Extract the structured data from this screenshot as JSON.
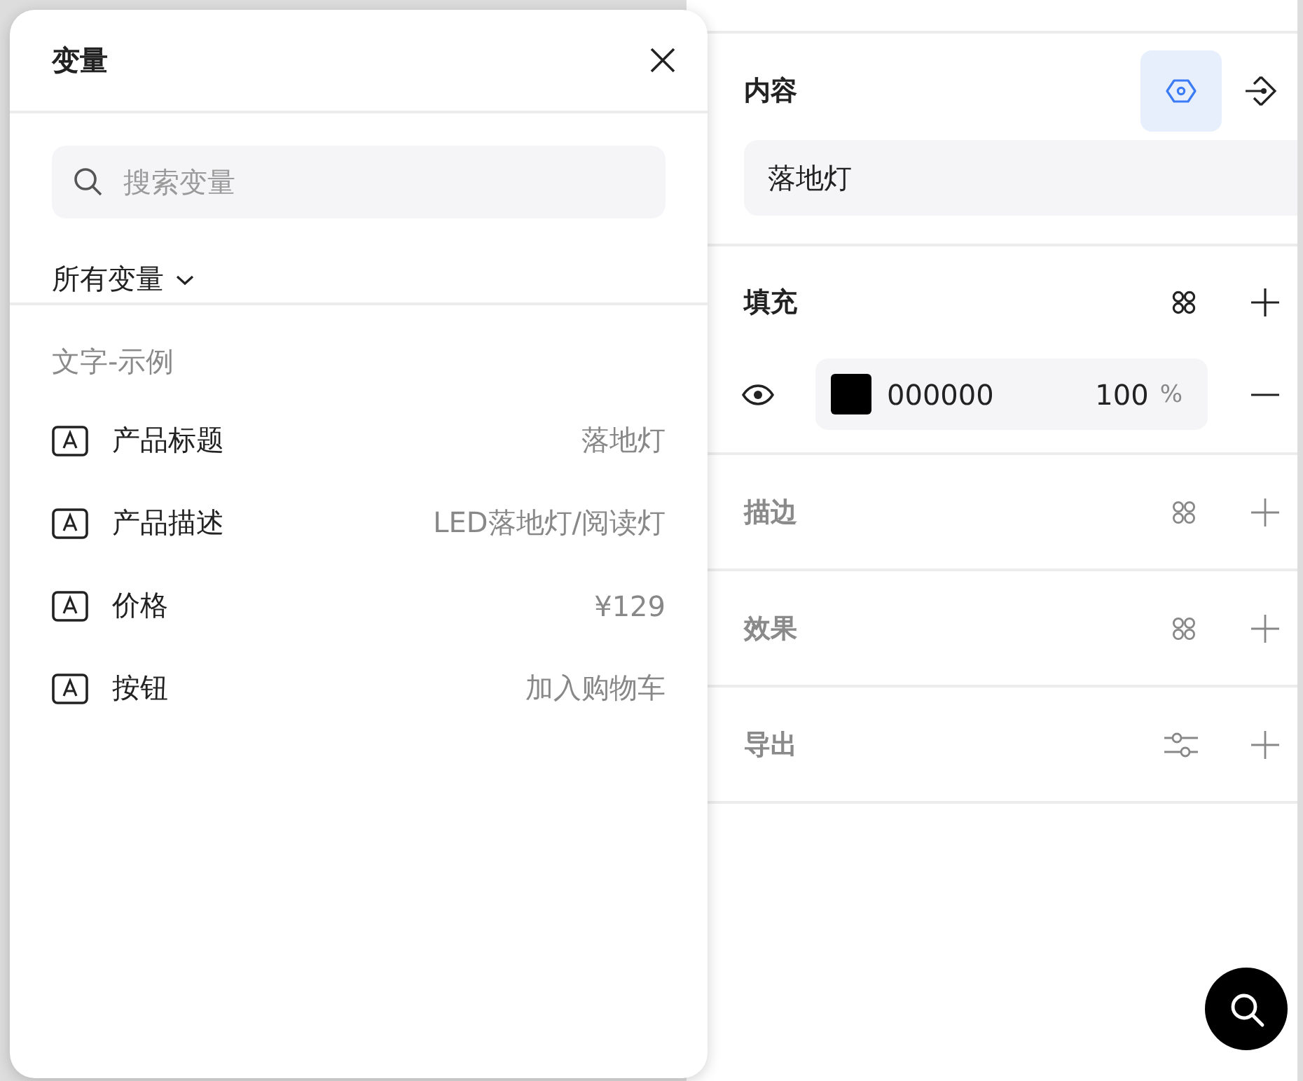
{
  "variables_panel": {
    "title": "变量",
    "search": {
      "placeholder": "搜索变量"
    },
    "filter": "所有变量",
    "group": "文字-示例",
    "items": [
      {
        "name": "产品标题",
        "value": "落地灯"
      },
      {
        "name": "产品描述",
        "value": "LED落地灯/阅读灯"
      },
      {
        "name": "价格",
        "value": "¥129"
      },
      {
        "name": "按钮",
        "value": "加入购物车"
      }
    ]
  },
  "properties": {
    "content": {
      "title": "内容",
      "value": "落地灯",
      "variable_button": {
        "selected": true
      }
    },
    "fill": {
      "title": "填充",
      "disabled": false,
      "layers": [
        {
          "visible": true,
          "color": "#000000",
          "hex": "000000",
          "opacity": "100",
          "unit": "%"
        }
      ]
    },
    "sections": [
      {
        "title": "描边",
        "kind": "styles",
        "disabled": true
      },
      {
        "title": "效果",
        "kind": "styles",
        "disabled": true
      },
      {
        "title": "导出",
        "kind": "sliders",
        "disabled": true
      }
    ]
  }
}
